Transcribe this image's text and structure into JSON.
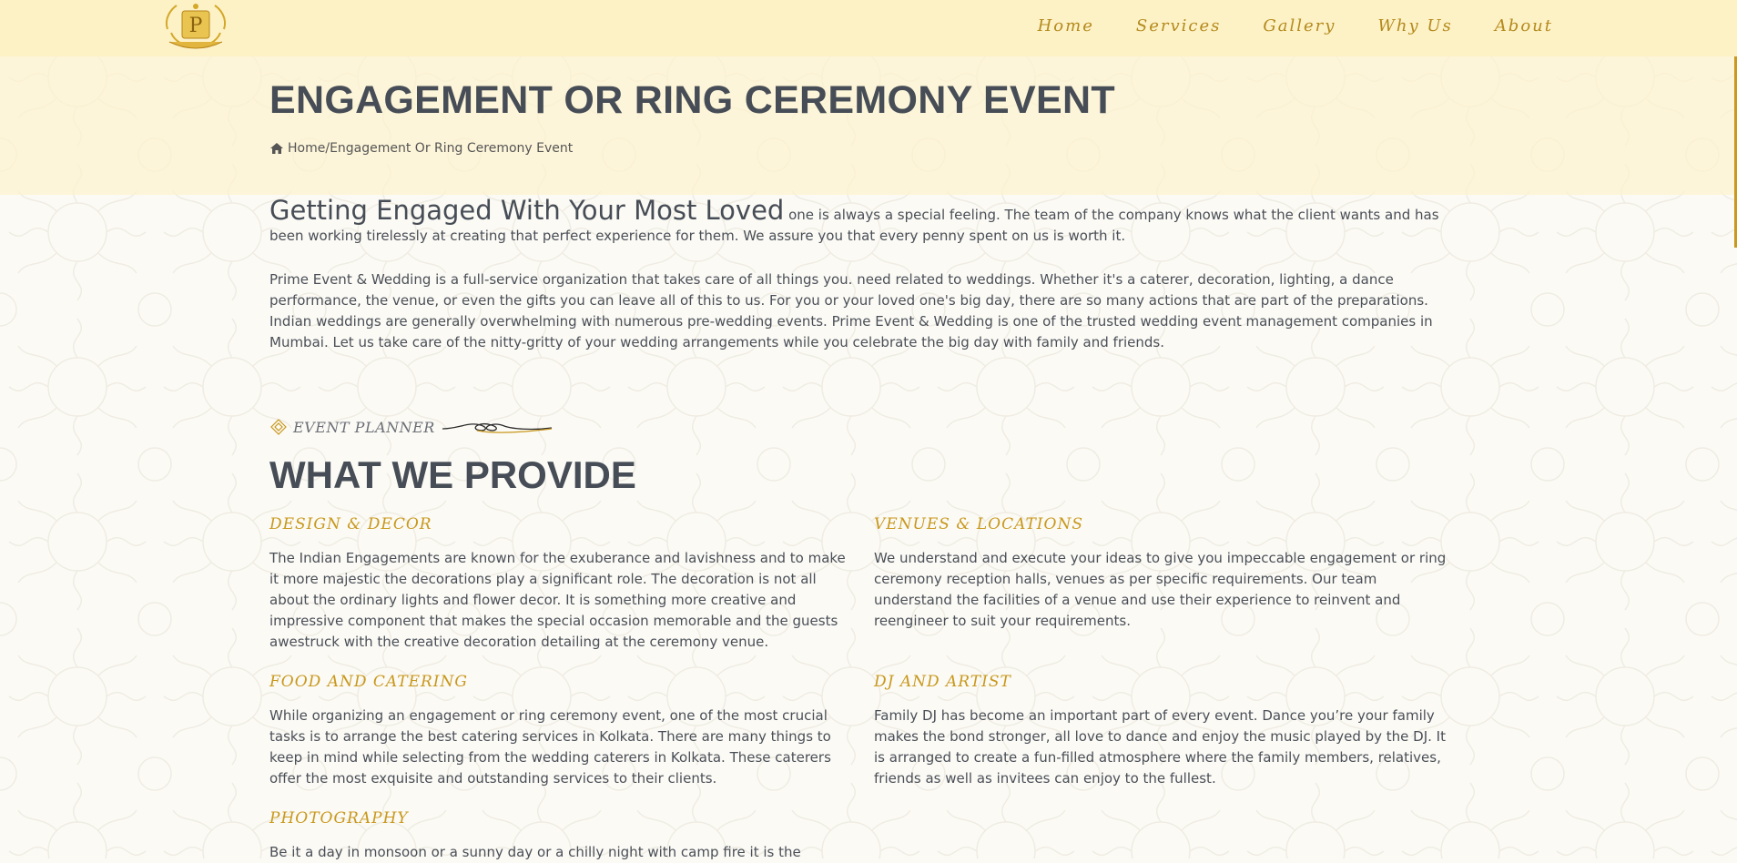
{
  "nav": {
    "items": [
      "Home",
      "Services",
      "Gallery",
      "Why Us",
      "About"
    ]
  },
  "page": {
    "title": "ENGAGEMENT OR RING CEREMONY EVENT",
    "breadcrumb_home": "Home",
    "breadcrumb_separator": "/",
    "breadcrumb_current": "Engagement Or Ring Ceremony Event"
  },
  "intro": {
    "lead": "Getting Engaged With Your Most Loved",
    "rest": "one is always a special feeling. The team of the company knows what the client wants and has been working tirelessly at creating that perfect experience for them. We assure you that every penny spent on us is worth it.",
    "paragraph2": "Prime Event & Wedding is a full-service organization that takes care of all things you. need related to weddings. Whether it's a caterer, decoration, lighting, a dance performance, the venue, or even the gifts you can leave all of this to us. For you or your loved one's big day, there are so many actions that are part of the preparations. Indian weddings are generally overwhelming with numerous pre-wedding events. Prime Event & Wedding is one of the trusted wedding event management companies in Mumbai. Let us take care of the nitty-gritty of your wedding arrangements while you celebrate the big day with family and friends."
  },
  "section": {
    "eyebrow": "EVENT PLANNER",
    "title": "WHAT WE PROVIDE"
  },
  "features": [
    {
      "title": "DESIGN & DECOR",
      "text": "The Indian Engagements are known for the exuberance and lavishness and to make it more majestic the decorations play a significant role. The decoration is not all about the ordinary lights and flower decor. It is something more creative and impressive component that makes the special occasion memorable and the guests awestruck with the creative decoration detailing at the ceremony venue."
    },
    {
      "title": "VENUES & LOCATIONS",
      "text": "We understand and execute your ideas to give you impeccable engagement or ring ceremony reception halls, venues as per specific requirements. Our team understand the facilities of a venue and use their experience to reinvent and reengineer to suit your requirements."
    },
    {
      "title": "FOOD AND CATERING",
      "text": "While organizing an engagement or ring ceremony event, one of the most crucial tasks is to arrange the best catering services in Kolkata. There are many things to keep in mind while selecting from the wedding caterers in Kolkata. These caterers offer the most exquisite and outstanding services to their clients."
    },
    {
      "title": "DJ AND ARTIST",
      "text": "Family DJ has become an important part of every event. Dance you’re your family makes the bond stronger, all love to dance and enjoy the music played by the DJ. It is arranged to create a fun-filled atmosphere where the family members, relatives, friends as well as invitees can enjoy to the fullest."
    },
    {
      "title": "PHOTOGRAPHY",
      "text": "Be it a day in monsoon or a sunny day or a chilly night with camp fire it is the"
    }
  ],
  "colors": {
    "header_bg": "#fdf1c6",
    "nav_gold": "#b48a1c",
    "heading_gold": "#c9981c",
    "heading_dark": "#474d56",
    "body_text": "#4a4f57"
  }
}
